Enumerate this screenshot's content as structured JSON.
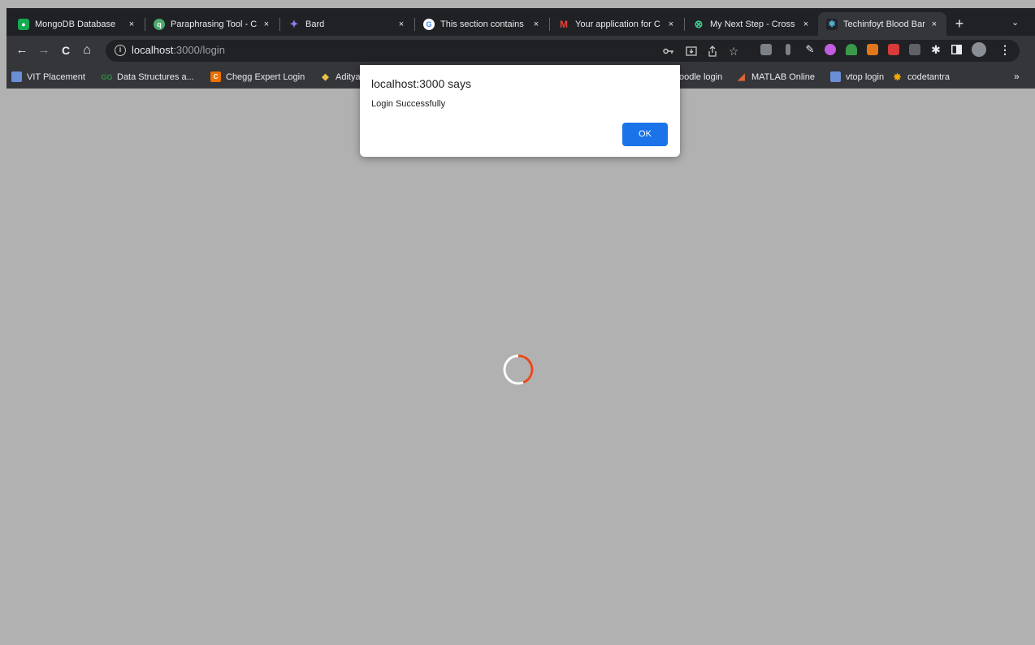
{
  "tabs": [
    {
      "title": "MongoDB Database",
      "favicon": "mongodb-icon",
      "color": "#13aa52"
    },
    {
      "title": "Paraphrasing Tool - C",
      "favicon": "quillbot-icon",
      "color": "#4aa96c"
    },
    {
      "title": "Bard",
      "favicon": "bard-sparkle-icon",
      "color": "#8e7cf0"
    },
    {
      "title": "This section contains",
      "favicon": "google-icon",
      "color": "#ffffff"
    },
    {
      "title": "Your application for C",
      "favicon": "gmail-icon",
      "color": "#ea4335"
    },
    {
      "title": "My Next Step - Cross",
      "favicon": "crossover-icon",
      "color": "#3ecf8e"
    },
    {
      "title": "Techinfoyt Blood Ban",
      "favicon": "react-icon",
      "color": "#61dafb"
    }
  ],
  "tab_close_glyph": "×",
  "new_tab_glyph": "+",
  "tab_menu_glyph": "⌄",
  "toolbar": {
    "back_glyph": "←",
    "forward_glyph": "→",
    "reload_glyph": "C",
    "home_glyph": "⌂",
    "info_glyph": "i",
    "url_host": "localhost",
    "url_rest": ":3000/login"
  },
  "bookmarks": [
    {
      "label": "VIT Placement",
      "icon": "vit-icon",
      "color": "#6b8fd6"
    },
    {
      "label": "Data Structures a...",
      "icon": "gfg-icon",
      "color": "#2f8d46"
    },
    {
      "label": "Chegg Expert Login",
      "icon": "chegg-icon",
      "color": "#eb7100"
    },
    {
      "label": "Aditya",
      "icon": "diamond-icon",
      "color": "#e8c34a"
    },
    {
      "label": "oodle login",
      "icon": "",
      "color": ""
    },
    {
      "label": "MATLAB Online",
      "icon": "matlab-icon",
      "color": "#e16737"
    },
    {
      "label": "vtop login",
      "icon": "vtop-icon",
      "color": "#6b8fd6"
    },
    {
      "label": "codetantra",
      "icon": "codetantra-icon",
      "color": "#f2a900"
    }
  ],
  "bookmarks_more": "»",
  "dialog": {
    "title": "localhost:3000 says",
    "message": "Login Successfully",
    "ok_label": "OK"
  },
  "spinner": {
    "track_color": "#ffffff",
    "accent_color": "#e8471c"
  }
}
